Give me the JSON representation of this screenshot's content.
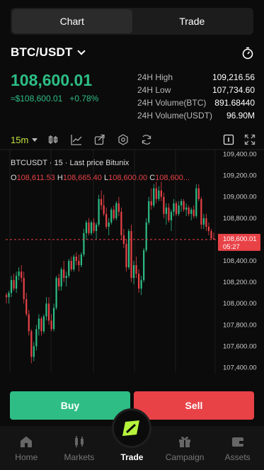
{
  "tabs": {
    "chart": "Chart",
    "trade": "Trade"
  },
  "pair": {
    "name": "BTC/USDT"
  },
  "ticker": {
    "last_price": "108,600.01",
    "last_price_fiat": "≈$108,600.01",
    "change_pct": "+0.78%",
    "stats": [
      {
        "label": "24H High",
        "value": "109,216.56"
      },
      {
        "label": "24H Low",
        "value": "107,734.60"
      },
      {
        "label": "24H Volume(BTC)",
        "value": "891.68440"
      },
      {
        "label": "24H Volume(USDT)",
        "value": "96.90M"
      }
    ]
  },
  "toolbar": {
    "timeframe": "15m"
  },
  "chart": {
    "header": "BTCUSDT · 15 · Last price Bitunix",
    "ohlc": {
      "o_label": "O",
      "o_value": "108,611.53",
      "h_label": "H",
      "h_value": "108,665.40",
      "l_label": "L",
      "l_value": "108,600.00",
      "c_label": "C",
      "c_value": "108,600..."
    },
    "price_tag": {
      "price": "108,600.01",
      "countdown": "05:27"
    },
    "colors": {
      "up": "#2ebd85",
      "down": "#e84247"
    }
  },
  "chart_data": {
    "type": "candlestick",
    "ylim": [
      107350,
      109450
    ],
    "y_ticks": [
      "109,400.00",
      "109,200.00",
      "109,000.00",
      "108,800.00",
      "108,600.00",
      "108,400.00",
      "108,200.00",
      "108,000.00",
      "107,800.00",
      "107,600.00",
      "107,400.00"
    ],
    "candles": [
      [
        108080,
        108100,
        108000,
        108060
      ],
      [
        108060,
        108120,
        108000,
        108100
      ],
      [
        108100,
        108260,
        108060,
        108220
      ],
      [
        108220,
        108280,
        108120,
        108140
      ],
      [
        108140,
        108300,
        108100,
        108260
      ],
      [
        108260,
        108340,
        108220,
        108300
      ],
      [
        108300,
        108360,
        108200,
        108240
      ],
      [
        108240,
        108300,
        108000,
        108040
      ],
      [
        108040,
        108100,
        107880,
        107900
      ],
      [
        107900,
        107940,
        107700,
        107740
      ],
      [
        107740,
        107760,
        107440,
        107500
      ],
      [
        107500,
        107640,
        107460,
        107600
      ],
      [
        107600,
        107800,
        107560,
        107760
      ],
      [
        107760,
        107900,
        107700,
        107860
      ],
      [
        107860,
        107880,
        107700,
        107740
      ],
      [
        107740,
        107900,
        107720,
        107880
      ],
      [
        107880,
        108060,
        107840,
        108000
      ],
      [
        108000,
        108060,
        107800,
        107840
      ],
      [
        107840,
        107900,
        107740,
        107760
      ],
      [
        107760,
        108000,
        107740,
        107960
      ],
      [
        107960,
        108260,
        107940,
        108240
      ],
      [
        108240,
        108280,
        108120,
        108160
      ],
      [
        108160,
        108340,
        108120,
        108320
      ],
      [
        108320,
        108400,
        108200,
        108240
      ],
      [
        108240,
        108300,
        108160,
        108260
      ],
      [
        108260,
        108420,
        108240,
        108400
      ],
      [
        108400,
        108440,
        108300,
        108320
      ],
      [
        108320,
        108460,
        108300,
        108440
      ],
      [
        108440,
        108480,
        108360,
        108400
      ],
      [
        108400,
        108460,
        108300,
        108360
      ],
      [
        108360,
        108480,
        108340,
        108460
      ],
      [
        108460,
        108700,
        108440,
        108660
      ],
      [
        108660,
        108780,
        108600,
        108760
      ],
      [
        108760,
        108800,
        108640,
        108660
      ],
      [
        108660,
        108780,
        108640,
        108760
      ],
      [
        108760,
        108800,
        108660,
        108680
      ],
      [
        108680,
        108760,
        108600,
        108740
      ],
      [
        108740,
        109020,
        108720,
        108980
      ],
      [
        108980,
        109060,
        108880,
        108920
      ],
      [
        108920,
        109020,
        108820,
        108840
      ],
      [
        108840,
        108900,
        108700,
        108720
      ],
      [
        108720,
        108800,
        108640,
        108760
      ],
      [
        108760,
        108900,
        108740,
        108880
      ],
      [
        108880,
        108920,
        108780,
        108800
      ],
      [
        108800,
        108960,
        108780,
        108940
      ],
      [
        108940,
        109000,
        108820,
        108860
      ],
      [
        108860,
        108900,
        108600,
        108640
      ],
      [
        108640,
        108700,
        108520,
        108560
      ],
      [
        108560,
        108600,
        108300,
        108340
      ],
      [
        108340,
        108700,
        108320,
        108680
      ],
      [
        108680,
        108740,
        108200,
        108240
      ],
      [
        108240,
        108400,
        108180,
        108360
      ],
      [
        108360,
        108440,
        108240,
        108280
      ],
      [
        108280,
        108320,
        108100,
        108140
      ],
      [
        108140,
        108260,
        108080,
        108220
      ],
      [
        108220,
        108520,
        108200,
        108500
      ],
      [
        108500,
        108800,
        108480,
        108760
      ],
      [
        108760,
        109000,
        108740,
        108960
      ],
      [
        108960,
        109080,
        108880,
        108920
      ],
      [
        108920,
        109120,
        108900,
        109080
      ],
      [
        109080,
        109140,
        108940,
        108980
      ],
      [
        108980,
        109100,
        108960,
        109060
      ],
      [
        109060,
        109140,
        108960,
        109000
      ],
      [
        109000,
        109040,
        108800,
        108840
      ],
      [
        108840,
        108940,
        108740,
        108900
      ],
      [
        108900,
        108940,
        108760,
        108780
      ],
      [
        108780,
        108880,
        108680,
        108860
      ],
      [
        108860,
        108980,
        108820,
        108940
      ],
      [
        108940,
        108960,
        108820,
        108840
      ],
      [
        108840,
        108960,
        108820,
        108920
      ],
      [
        108920,
        108980,
        108860,
        108960
      ],
      [
        108960,
        108980,
        108860,
        108880
      ],
      [
        108880,
        108940,
        108820,
        108900
      ],
      [
        108900,
        108920,
        108820,
        108840
      ],
      [
        108840,
        108900,
        108780,
        108880
      ],
      [
        108880,
        108920,
        108800,
        108820
      ],
      [
        108820,
        109120,
        108800,
        109080
      ],
      [
        109080,
        109120,
        108960,
        108980
      ],
      [
        108980,
        109000,
        108700,
        108740
      ],
      [
        108740,
        108840,
        108700,
        108800
      ],
      [
        108800,
        108840,
        108680,
        108720
      ],
      [
        108720,
        108760,
        108640,
        108680
      ],
      [
        108680,
        108700,
        108600,
        108611
      ],
      [
        108611,
        108665,
        108600,
        108600
      ]
    ]
  },
  "actions": {
    "buy": "Buy",
    "sell": "Sell"
  },
  "nav": [
    {
      "label": "Home"
    },
    {
      "label": "Markets"
    },
    {
      "label": "Trade"
    },
    {
      "label": "Campaign"
    },
    {
      "label": "Assets"
    }
  ]
}
